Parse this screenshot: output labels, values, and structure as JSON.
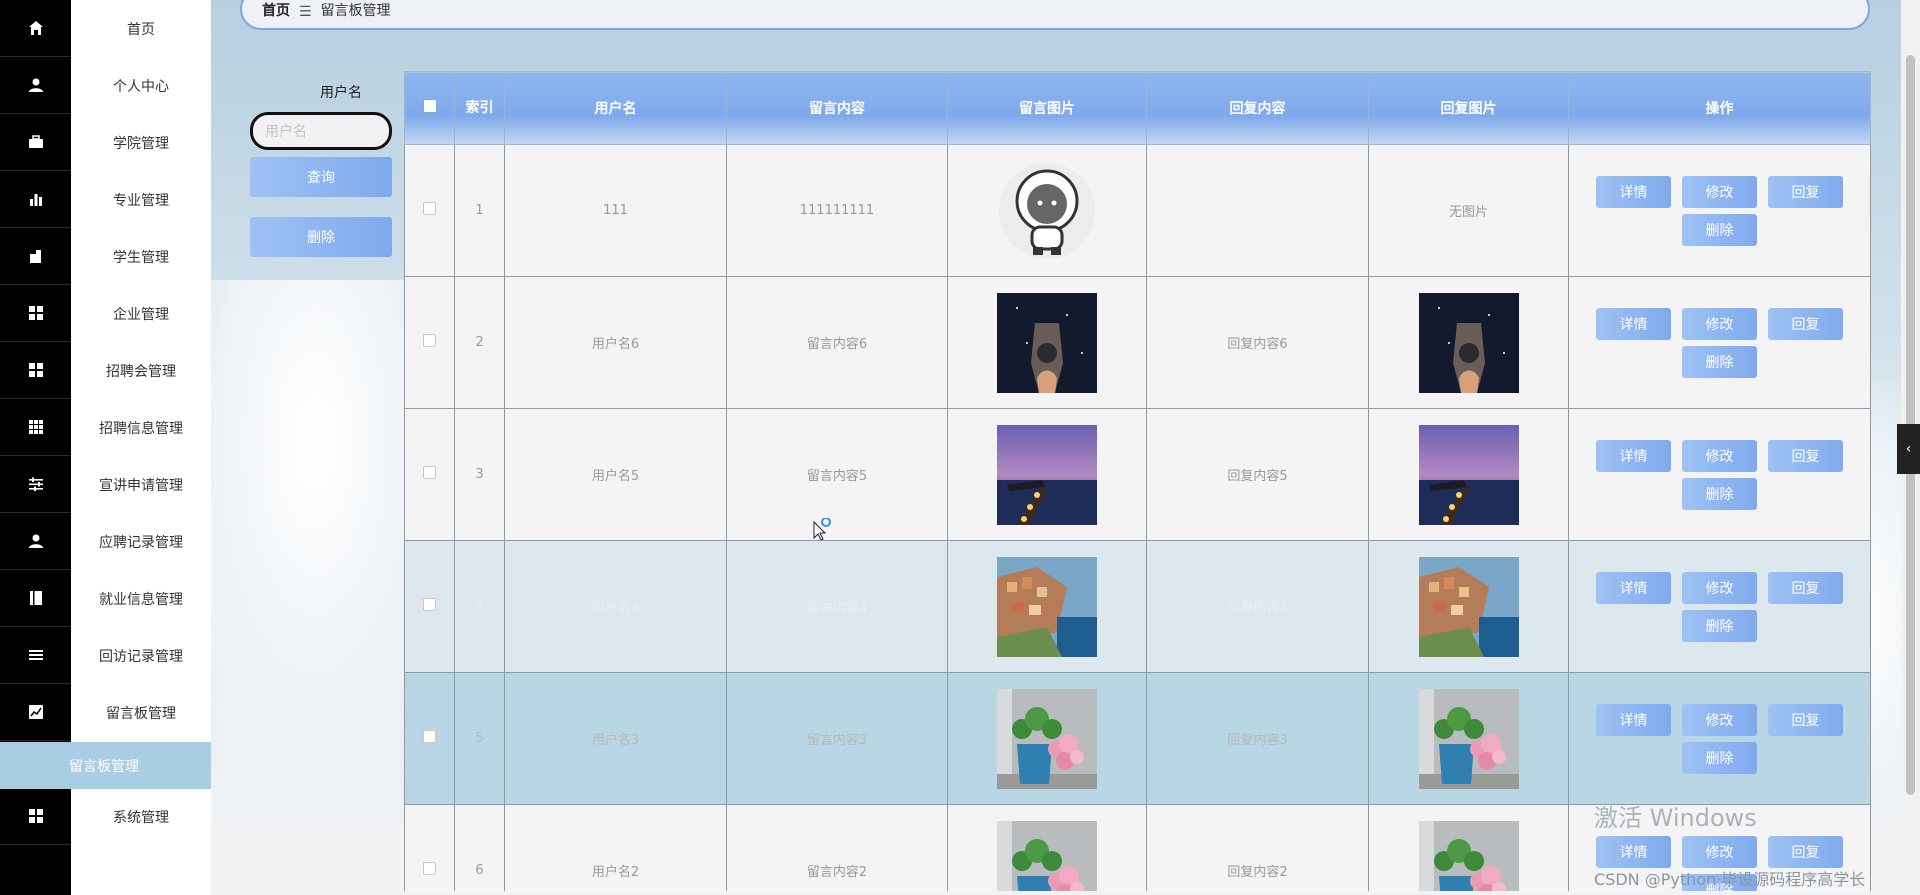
{
  "menu": {
    "items": [
      {
        "label": "首页",
        "icon": "home-icon"
      },
      {
        "label": "个人中心",
        "icon": "user-icon"
      },
      {
        "label": "学院管理",
        "icon": "briefcase-icon"
      },
      {
        "label": "专业管理",
        "icon": "bar-chart-icon"
      },
      {
        "label": "学生管理",
        "icon": "puzzle-icon"
      },
      {
        "label": "企业管理",
        "icon": "grid-icon"
      },
      {
        "label": "招聘会管理",
        "icon": "grid-icon"
      },
      {
        "label": "招聘信息管理",
        "icon": "table-icon"
      },
      {
        "label": "宣讲申请管理",
        "icon": "sliders-icon"
      },
      {
        "label": "应聘记录管理",
        "icon": "user-icon"
      },
      {
        "label": "就业信息管理",
        "icon": "book-icon"
      },
      {
        "label": "回访记录管理",
        "icon": "list-icon"
      },
      {
        "label": "留言板管理",
        "icon": "line-chart-icon"
      }
    ],
    "active_sub": "留言板管理",
    "system": {
      "label": "系统管理",
      "icon": "grid-icon"
    }
  },
  "breadcrumb": {
    "home": "首页",
    "separator": "☰",
    "current": "留言板管理"
  },
  "search": {
    "label": "用户名",
    "placeholder": "用户名",
    "query_button": "查询",
    "delete_button": "删除"
  },
  "table": {
    "headers": [
      "索引",
      "用户名",
      "留言内容",
      "留言图片",
      "回复内容",
      "回复图片",
      "操作"
    ],
    "rows": [
      {
        "index": "1",
        "username": "111",
        "content": "111111111",
        "image": "astronaut",
        "reply": "",
        "reply_image": "",
        "reply_image_text": "无图片"
      },
      {
        "index": "2",
        "username": "用户名6",
        "content": "留言内容6",
        "image": "night-sky",
        "reply": "回复内容6",
        "reply_image": "night-sky",
        "reply_image_text": ""
      },
      {
        "index": "3",
        "username": "用户名5",
        "content": "留言内容5",
        "image": "lake-dusk",
        "reply": "回复内容5",
        "reply_image": "lake-dusk",
        "reply_image_text": ""
      },
      {
        "index": "4",
        "username": "用户名4",
        "content": "留言内容4",
        "image": "cliff-town",
        "reply": "回复内容4",
        "reply_image": "cliff-town",
        "reply_image_text": ""
      },
      {
        "index": "5",
        "username": "用户名3",
        "content": "留言内容3",
        "image": "flower-pot",
        "reply": "回复内容3",
        "reply_image": "flower-pot",
        "reply_image_text": ""
      },
      {
        "index": "6",
        "username": "用户名2",
        "content": "留言内容2",
        "image": "flower-pot",
        "reply": "回复内容2",
        "reply_image": "flower-pot",
        "reply_image_text": ""
      }
    ],
    "actions": {
      "detail": "详情",
      "edit": "修改",
      "reply": "回复",
      "delete": "删除"
    }
  },
  "overlay": {
    "watermark": "激活 Windows",
    "csdn": "CSDN @Python·毕设源码程序高学长"
  },
  "colors": {
    "accent": "#80aaee",
    "rail": "#000000",
    "active_menu": "#a9cde2"
  }
}
